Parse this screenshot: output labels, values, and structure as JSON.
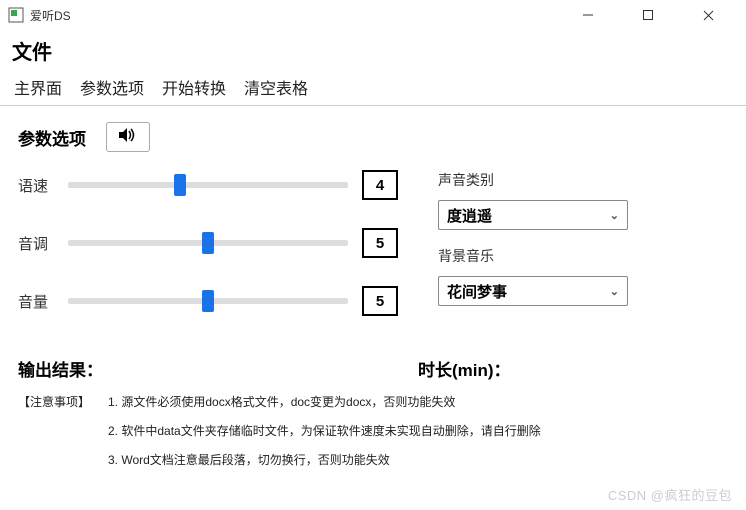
{
  "window": {
    "title": "爱听DS"
  },
  "menubar1": {
    "file": "文件"
  },
  "menubar2": {
    "main": "主界面",
    "params": "参数选项",
    "start": "开始转换",
    "clear": "清空表格"
  },
  "panel": {
    "title": "参数选项",
    "sliders": {
      "speed": {
        "label": "语速",
        "value": "4",
        "pos": 40
      },
      "pitch": {
        "label": "音调",
        "value": "5",
        "pos": 50
      },
      "volume": {
        "label": "音量",
        "value": "5",
        "pos": 50
      }
    },
    "voice_type": {
      "label": "声音类别",
      "value": "度逍遥"
    },
    "bgm": {
      "label": "背景音乐",
      "value": "花间梦事"
    }
  },
  "output": {
    "result_label": "输出结果：",
    "duration_label": "时长(min)："
  },
  "notes": {
    "tag": "【注意事项】",
    "items": [
      "1. 源文件必须使用docx格式文件，doc变更为docx，否则功能失效",
      "2. 软件中data文件夹存储临时文件，为保证软件速度未实现自动删除，请自行删除",
      "3. Word文档注意最后段落，切勿换行，否则功能失效"
    ]
  },
  "watermark": "CSDN @疯狂的豆包"
}
